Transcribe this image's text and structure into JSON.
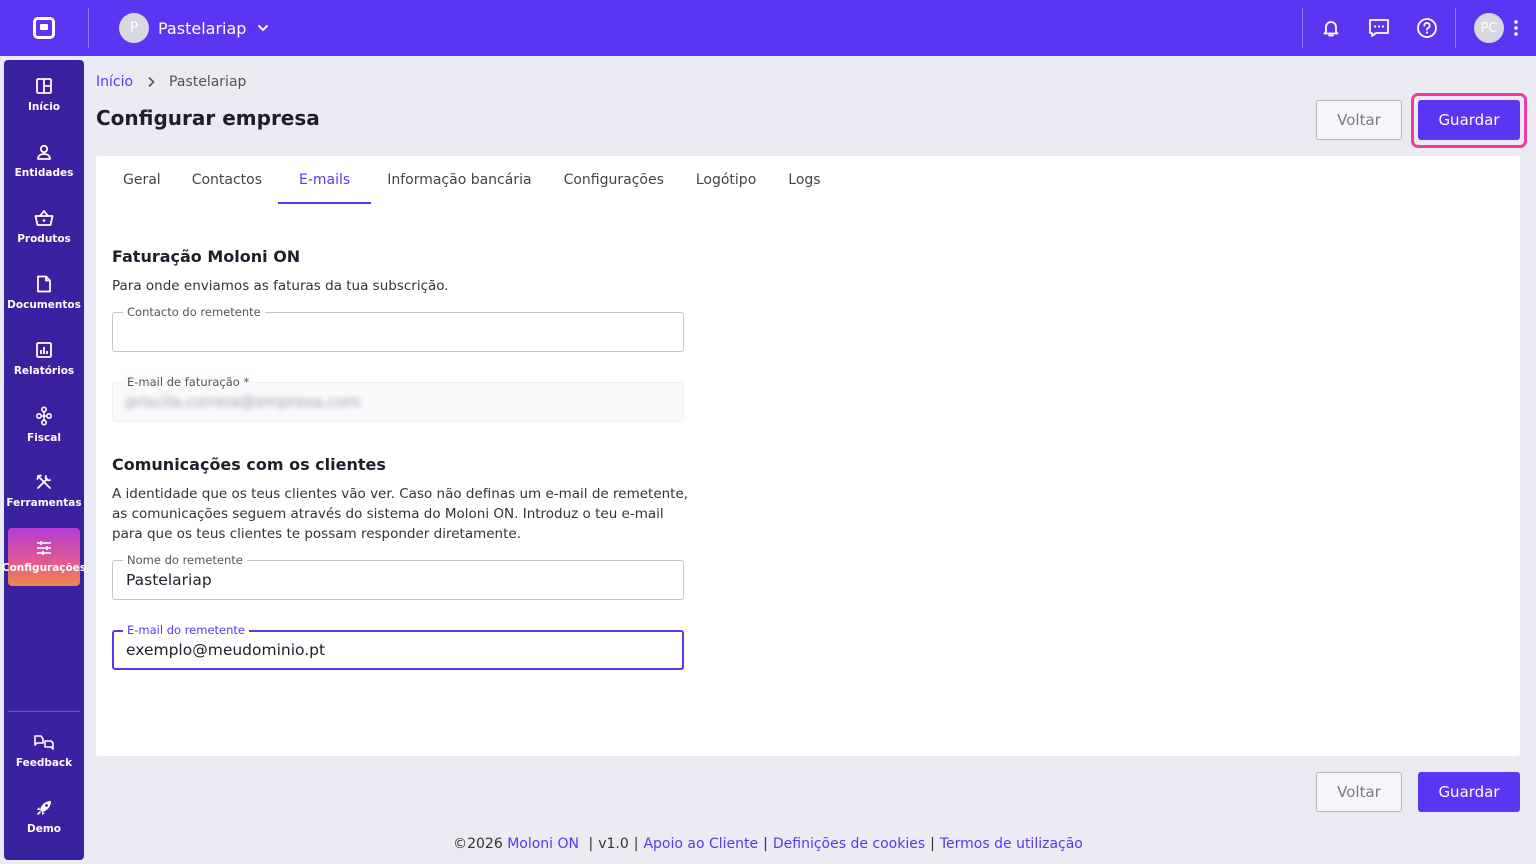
{
  "header": {
    "company_initial": "P",
    "company_name": "Pastelariap",
    "user_initials": "PC"
  },
  "sidebar": {
    "items": [
      {
        "label": "Início",
        "icon": "grid-icon"
      },
      {
        "label": "Entidades",
        "icon": "person-icon"
      },
      {
        "label": "Produtos",
        "icon": "basket-icon"
      },
      {
        "label": "Documentos",
        "icon": "document-icon"
      },
      {
        "label": "Relatórios",
        "icon": "chart-icon"
      },
      {
        "label": "Fiscal",
        "icon": "fiscal-icon"
      },
      {
        "label": "Ferramentas",
        "icon": "tools-icon"
      },
      {
        "label": "Configurações",
        "icon": "sliders-icon"
      }
    ],
    "bottom": [
      {
        "label": "Feedback",
        "icon": "feedback-icon"
      },
      {
        "label": "Demo",
        "icon": "rocket-icon"
      }
    ],
    "active": "Configurações"
  },
  "breadcrumb": {
    "home": "Início",
    "current": "Pastelariap"
  },
  "page": {
    "title": "Configurar empresa",
    "back_label": "Voltar",
    "save_label": "Guardar"
  },
  "tabs": [
    "Geral",
    "Contactos",
    "E-mails",
    "Informação bancária",
    "Configurações",
    "Logótipo",
    "Logs"
  ],
  "active_tab": "E-mails",
  "billing": {
    "title": "Faturação Moloni ON",
    "desc": "Para onde enviamos as faturas da tua subscrição.",
    "contact_label": "Contacto do remetente",
    "contact_value": "",
    "email_label": "E-mail de faturação *",
    "email_value": "priscila.correia@empresa.com"
  },
  "communications": {
    "title": "Comunicações com os clientes",
    "desc": "A identidade que os teus clientes vão ver. Caso não definas um e-mail de remetente, as comunicações seguem através do sistema do Moloni ON. Introduz o teu e-mail para que os teus clientes te possam responder diretamente.",
    "sender_name_label": "Nome do remetente",
    "sender_name_value": "Pastelariap",
    "sender_email_label": "E-mail do remetente",
    "sender_email_value": "exemplo@meudominio.pt"
  },
  "footer": {
    "copyright": "©2026",
    "brand": "Moloni ON",
    "version": "v1.0",
    "support": "Apoio ao Cliente",
    "cookies": "Definições de cookies",
    "terms": "Termos de utilização"
  },
  "colors": {
    "primary": "#5b36f2",
    "sidebar": "#3a21a0",
    "highlight": "#ef3aa0"
  }
}
